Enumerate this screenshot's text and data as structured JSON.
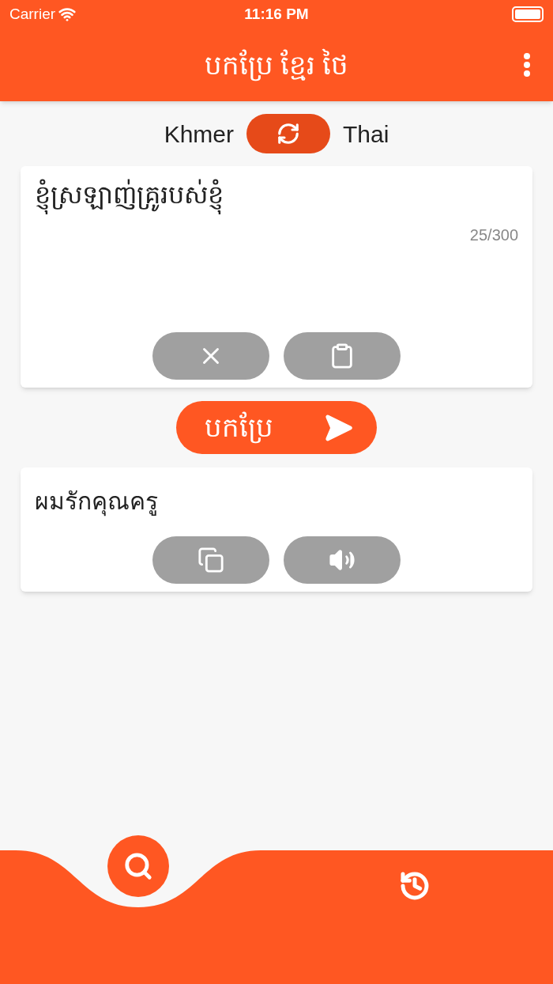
{
  "status_bar": {
    "carrier": "Carrier",
    "time": "11:16 PM"
  },
  "app_bar": {
    "title": "បកប្រែ ខ្មែរ ថៃ"
  },
  "languages": {
    "source": "Khmer",
    "target": "Thai"
  },
  "input": {
    "value": "ខ្ញុំស្រឡាញ់គ្រូរបស់ខ្ញុំ",
    "count": "25/300"
  },
  "translate_button": {
    "label": "បកប្រែ"
  },
  "output": {
    "text": "ผมรักคุณครู"
  },
  "bottom_nav": [
    {
      "kind": "search",
      "selected": true
    },
    {
      "kind": "history",
      "selected": false
    }
  ]
}
